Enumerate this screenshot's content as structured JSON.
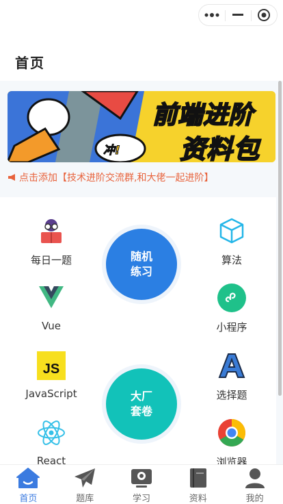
{
  "header": {
    "title": "首页"
  },
  "capsule": {
    "more_icon": "more-dots-icon",
    "minimize_icon": "minimize-icon",
    "close_icon": "target-close-icon"
  },
  "banner": {
    "line1": "前端进阶",
    "line2": "资料包",
    "sticker": "冲!"
  },
  "notice": {
    "text": "点击添加【技术进阶交流群,和大佬一起进阶】",
    "icon": "megaphone-icon",
    "color": "#e8623b"
  },
  "grid": {
    "items": [
      {
        "label": "每日一题",
        "icon": "reading-person-icon"
      },
      {
        "label": "算法",
        "icon": "cube-icon"
      },
      {
        "label": "Vue",
        "icon": "vue-logo-icon"
      },
      {
        "label": "小程序",
        "icon": "mini-program-icon"
      },
      {
        "label": "JavaScript",
        "icon": "js-logo-icon"
      },
      {
        "label": "选择题",
        "icon": "letter-a-icon"
      },
      {
        "label": "React",
        "icon": "react-logo-icon"
      },
      {
        "label": "浏览器",
        "icon": "chrome-icon"
      }
    ],
    "circles": [
      {
        "line1": "随机",
        "line2": "练习",
        "color": "#2b7fe3"
      },
      {
        "line1": "大厂",
        "line2": "套卷",
        "color": "#12c2b9"
      }
    ]
  },
  "tabbar": {
    "tabs": [
      {
        "label": "首页",
        "icon": "home-icon",
        "active": true
      },
      {
        "label": "题库",
        "icon": "paper-plane-icon",
        "active": false
      },
      {
        "label": "学习",
        "icon": "tv-icon",
        "active": false
      },
      {
        "label": "资料",
        "icon": "book-icon",
        "active": false
      },
      {
        "label": "我的",
        "icon": "user-icon",
        "active": false
      }
    ]
  }
}
